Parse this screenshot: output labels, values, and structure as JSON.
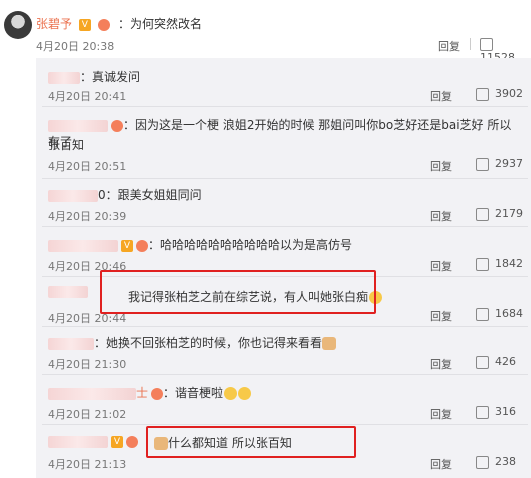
{
  "top_comment": {
    "author": "张碧予",
    "text": "：为何突然改名",
    "time": "4月20日 20:38",
    "reply_label": "回复",
    "likes": "11528"
  },
  "replies": [
    {
      "name_suffix": "",
      "text": "：真诚发问",
      "time": "4月20日 20:41",
      "likes": "3902"
    },
    {
      "name_suffix": "",
      "text": "：因为这是一个梗 浪姐2开始的时候 那姐问叫你bo芝好还是bai芝好 所以有了",
      "text2": "张百知",
      "time": "4月20日 20:51",
      "likes": "2937"
    },
    {
      "name_suffix": "0",
      "text": "：跟美女姐姐同问",
      "time": "4月20日 20:39",
      "likes": "2179"
    },
    {
      "name_suffix": "",
      "text": "：哈哈哈哈哈哈哈哈哈哈以为是高仿号",
      "time": "4月20日 20:46",
      "likes": "1842"
    },
    {
      "name_suffix": "",
      "text": "我记得张柏芝之前在综艺说，有人叫她张白痴",
      "time": "4月20日 20:44",
      "likes": "1684"
    },
    {
      "name_suffix": "",
      "text": "：她换不回张柏芝的时候，你也记得来看看",
      "time": "4月20日 21:30",
      "likes": "426"
    },
    {
      "name_suffix": "士",
      "text": "：谐音梗啦",
      "time": "4月20日 21:02",
      "likes": "316"
    },
    {
      "name_suffix": "",
      "text": "什么都知道 所以张百知",
      "time": "4月20日 21:13",
      "likes": "238"
    }
  ],
  "reply_label": "回复",
  "icons": [
    "thumbs-up-icon",
    "avatar",
    "vip-badge-icon",
    "fan-badge-icon",
    "laugh-emoji-icon",
    "cat-emoji-icon"
  ]
}
